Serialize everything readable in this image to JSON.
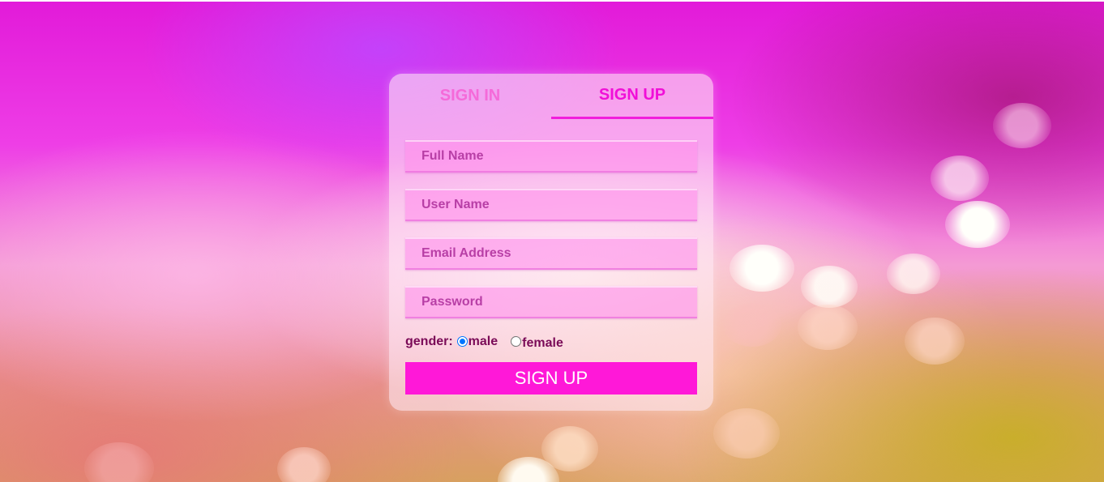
{
  "tabs": {
    "sign_in": "SIGN IN",
    "sign_up": "SIGN UP",
    "active": "sign_up"
  },
  "form": {
    "full_name_placeholder": "Full Name",
    "user_name_placeholder": "User Name",
    "email_placeholder": "Email Address",
    "password_placeholder": "Password",
    "gender_label": "gender:",
    "gender_options": [
      "male",
      "female"
    ],
    "gender_selected": "male",
    "submit_label": "SIGN UP"
  },
  "colors": {
    "accent": "#ff18d8",
    "active_tab_text": "#f10ed8",
    "inactive_tab_text": "#f56ad9"
  }
}
